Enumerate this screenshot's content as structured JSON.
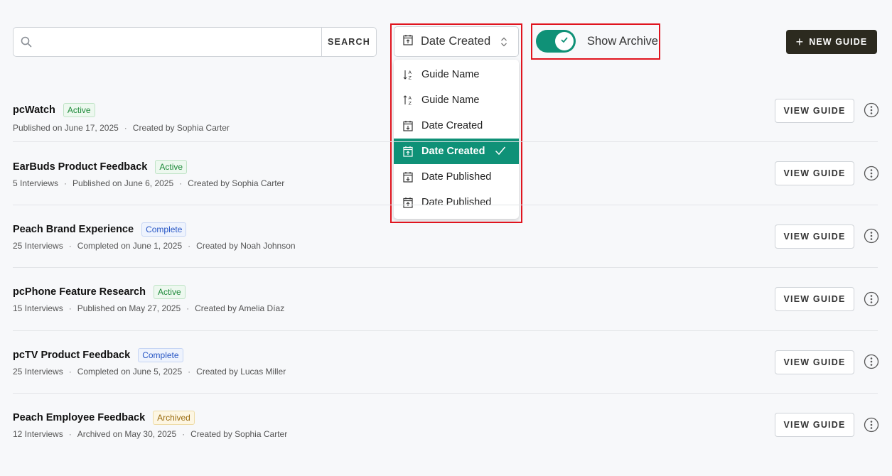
{
  "toolbar": {
    "search_placeholder": "",
    "search_value": "",
    "search_button": "SEARCH",
    "sort_selected": "Date Created",
    "archive_toggle_label": "Show Archive",
    "archive_toggle_on": true,
    "new_guide_label": "NEW GUIDE"
  },
  "sort_menu": {
    "items": [
      {
        "label": "Guide Name",
        "icon": "sort-alpha-down-icon"
      },
      {
        "label": "Guide Name",
        "icon": "sort-alpha-up-icon"
      },
      {
        "label": "Date Created",
        "icon": "calendar-arrow-down-icon"
      },
      {
        "label": "Date Created",
        "icon": "calendar-arrow-up-icon",
        "selected": true
      },
      {
        "label": "Date Published",
        "icon": "calendar-arrow-down-icon"
      },
      {
        "label": "Date Published",
        "icon": "calendar-arrow-up-icon"
      }
    ]
  },
  "guides": [
    {
      "title": "pcWatch",
      "status": "Active",
      "meta": [
        "Published on June 17, 2025",
        "Created by Sophia Carter"
      ],
      "action": "VIEW GUIDE"
    },
    {
      "title": "EarBuds Product Feedback",
      "status": "Active",
      "meta": [
        "5 Interviews",
        "Published on June 6, 2025",
        "Created by Sophia Carter"
      ],
      "action": "VIEW GUIDE"
    },
    {
      "title": "Peach Brand Experience",
      "status": "Complete",
      "meta": [
        "25 Interviews",
        "Completed on June 1, 2025",
        "Created by Noah Johnson"
      ],
      "action": "VIEW GUIDE"
    },
    {
      "title": "pcPhone Feature Research",
      "status": "Active",
      "meta": [
        "15 Interviews",
        "Published on May 27, 2025",
        "Created by Amelia Díaz"
      ],
      "action": "VIEW GUIDE"
    },
    {
      "title": "pcTV Product Feedback",
      "status": "Complete",
      "meta": [
        "25 Interviews",
        "Completed on June 5, 2025",
        "Created by Lucas Miller"
      ],
      "action": "VIEW GUIDE"
    },
    {
      "title": "Peach Employee Feedback",
      "status": "Archived",
      "meta": [
        "12 Interviews",
        "Archived on May 30, 2025",
        "Created by Sophia Carter"
      ],
      "action": "VIEW GUIDE"
    }
  ],
  "colors": {
    "accent": "#0f9177",
    "primary_button": "#2c2a1f",
    "highlight_box": "#e0141e"
  }
}
